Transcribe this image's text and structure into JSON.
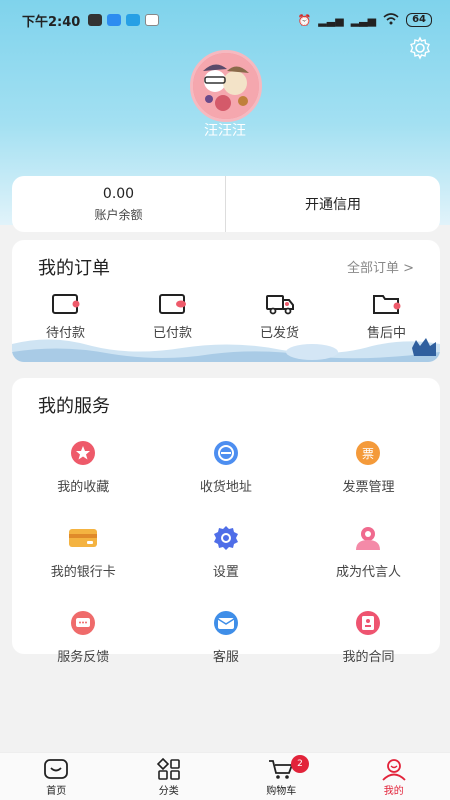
{
  "status_bar": {
    "time": "下午2:40",
    "battery": "64"
  },
  "profile": {
    "username": "汪汪汪"
  },
  "balance": {
    "value": "0.00",
    "label": "账户余额",
    "credit_label": "开通信用"
  },
  "orders": {
    "title": "我的订单",
    "all_link": "全部订单 >",
    "items": [
      {
        "label": "待付款",
        "icon": "wallet-pending-icon"
      },
      {
        "label": "已付款",
        "icon": "wallet-paid-icon"
      },
      {
        "label": "已发货",
        "icon": "truck-icon"
      },
      {
        "label": "售后中",
        "icon": "folder-after-sale-icon"
      }
    ]
  },
  "services": {
    "title": "我的服务",
    "items": [
      {
        "label": "我的收藏",
        "icon": "star-icon",
        "color": "#ee5a6a"
      },
      {
        "label": "收货地址",
        "icon": "address-icon",
        "color": "#4d8ef0"
      },
      {
        "label": "发票管理",
        "icon": "invoice-icon",
        "color": "#f49a3a",
        "glyph": "票"
      },
      {
        "label": "我的银行卡",
        "icon": "bank-card-icon",
        "color": "#f4b341"
      },
      {
        "label": "设置",
        "icon": "settings-icon",
        "color": "#4f6ee8"
      },
      {
        "label": "成为代言人",
        "icon": "spokesperson-icon",
        "color": "#f06a8e"
      },
      {
        "label": "服务反馈",
        "icon": "feedback-icon",
        "color": "#ef6b6b"
      },
      {
        "label": "客服",
        "icon": "customer-service-icon",
        "color": "#3f8ee8"
      },
      {
        "label": "我的合同",
        "icon": "contract-icon",
        "color": "#ee5470"
      }
    ]
  },
  "tabbar": {
    "tabs": [
      {
        "label": "首页",
        "icon": "home-icon"
      },
      {
        "label": "分类",
        "icon": "category-icon"
      },
      {
        "label": "购物车",
        "icon": "cart-icon",
        "badge": "2"
      },
      {
        "label": "我的",
        "icon": "profile-icon"
      }
    ],
    "active_color": "#e2233a"
  }
}
